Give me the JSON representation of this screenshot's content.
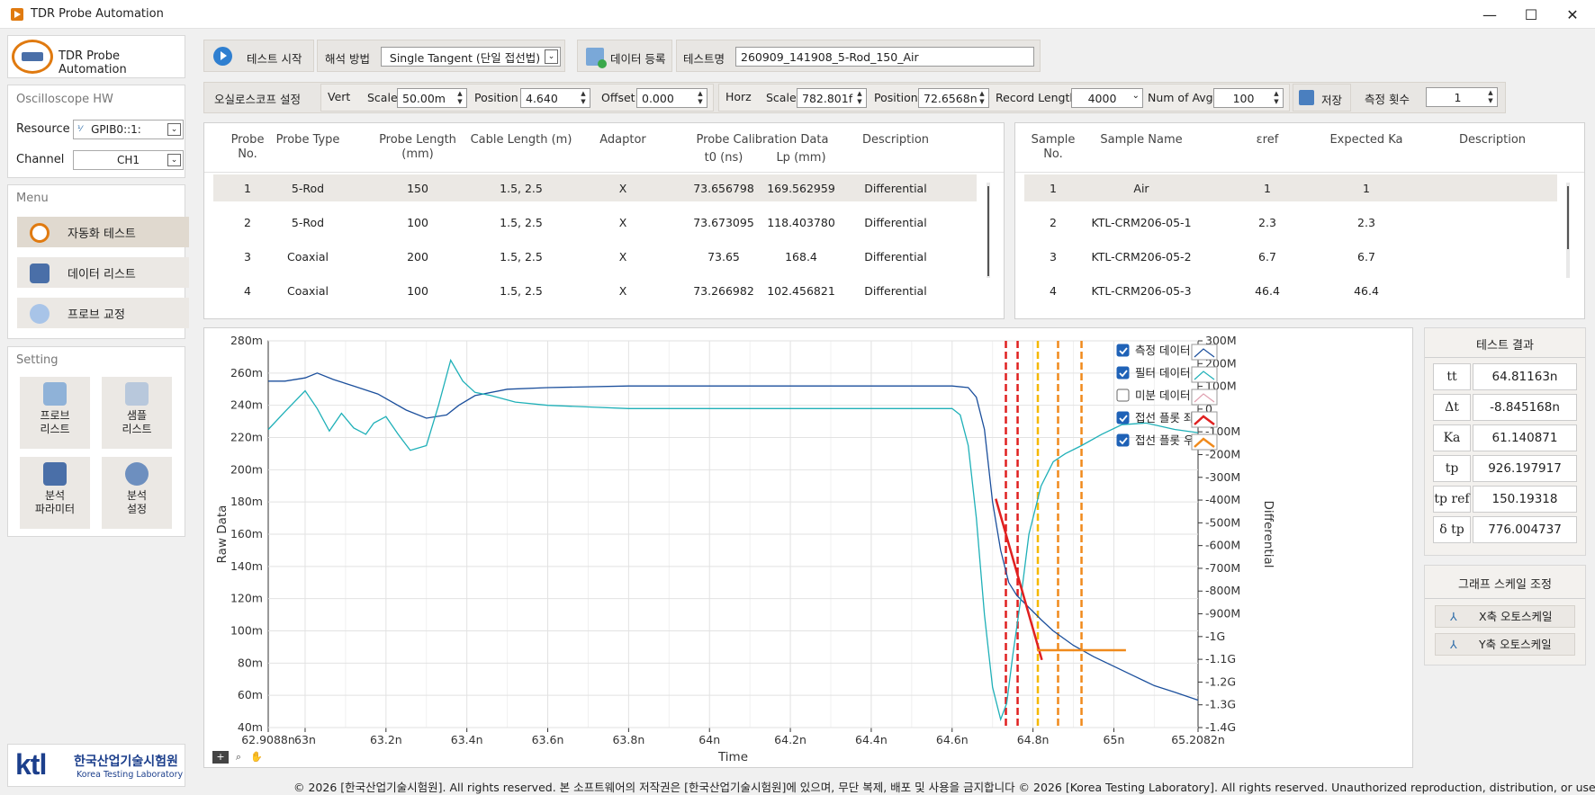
{
  "window": {
    "title": "TDR Probe Automation"
  },
  "sidebar": {
    "app_name": "TDR Probe Automation",
    "osc_hw": {
      "title": "Oscilloscope HW",
      "resource_label": "Resource",
      "resource_value": "GPIB0::1:",
      "channel_label": "Channel",
      "channel_value": "CH1"
    },
    "menu": {
      "title": "Menu",
      "items": [
        {
          "label": "자동화 테스트"
        },
        {
          "label": "데이터 리스트"
        },
        {
          "label": "프로브 교정"
        }
      ]
    },
    "setting": {
      "title": "Setting",
      "buttons": [
        {
          "line1": "프로브",
          "line2": "리스트"
        },
        {
          "line1": "샘플",
          "line2": "리스트"
        },
        {
          "line1": "분석",
          "line2": "파라미터"
        },
        {
          "line1": "분석",
          "line2": "설정"
        }
      ]
    },
    "logo": {
      "brand": "ktl",
      "name_ko": "한국산업기술시험원",
      "name_en": "Korea Testing Laboratory"
    }
  },
  "toolbar": {
    "start_test": "테스트 시작",
    "method_label": "해석 방법",
    "method_value": "Single Tangent (단일 접선법)",
    "register_data": "데이터 등록",
    "test_name_label": "테스트명",
    "test_name_value": "260909_141908_5-Rod_150_Air"
  },
  "scope": {
    "label": "오실로스코프 설정",
    "vert": "Vert",
    "vert_scale_label": "Scale",
    "vert_scale": "50.00m",
    "vert_pos_label": "Position",
    "vert_pos": "4.640",
    "offset_label": "Offset",
    "offset": "0.000",
    "horz": "Horz",
    "horz_scale_label": "Scale",
    "horz_scale": "782.801f",
    "horz_pos_label": "Position",
    "horz_pos": "72.6568n",
    "record_label": "Record Length",
    "record": "4000",
    "avg_label": "Num of Avg",
    "avg": "100",
    "save": "저장",
    "count_label": "측정 횟수",
    "count": "1"
  },
  "probe_table": {
    "headers": [
      "Probe\nNo.",
      "Probe Type",
      "Probe Length\n(mm)",
      "Cable Length (m)",
      "Adaptor",
      "Probe Calibration Data",
      "Description"
    ],
    "calib_sub": [
      "t0 (ns)",
      "Lp (mm)"
    ],
    "rows": [
      {
        "no": "1",
        "type": "5-Rod",
        "length": "150",
        "cable": "1.5, 2.5",
        "adaptor": "X",
        "t0": "73.656798",
        "lp": "169.562959",
        "desc": "Differential"
      },
      {
        "no": "2",
        "type": "5-Rod",
        "length": "100",
        "cable": "1.5, 2.5",
        "adaptor": "X",
        "t0": "73.673095",
        "lp": "118.403780",
        "desc": "Differential"
      },
      {
        "no": "3",
        "type": "Coaxial",
        "length": "200",
        "cable": "1.5, 2.5",
        "adaptor": "X",
        "t0": "73.65",
        "lp": "168.4",
        "desc": "Differential"
      },
      {
        "no": "4",
        "type": "Coaxial",
        "length": "100",
        "cable": "1.5, 2.5",
        "adaptor": "X",
        "t0": "73.266982",
        "lp": "102.456821",
        "desc": "Differential"
      }
    ]
  },
  "sample_table": {
    "headers": [
      "Sample\nNo.",
      "Sample Name",
      "εref",
      "Expected Ka",
      "Description"
    ],
    "rows": [
      {
        "no": "1",
        "name": "Air",
        "eref": "1",
        "ka": "1"
      },
      {
        "no": "2",
        "name": "KTL-CRM206-05-1",
        "eref": "2.3",
        "ka": "2.3"
      },
      {
        "no": "3",
        "name": "KTL-CRM206-05-2",
        "eref": "6.7",
        "ka": "6.7"
      },
      {
        "no": "4",
        "name": "KTL-CRM206-05-3",
        "eref": "46.4",
        "ka": "46.4"
      }
    ]
  },
  "chart_data": {
    "type": "line",
    "xlabel": "Time",
    "ylabel": "Raw Data",
    "y2label": "Differential",
    "xlim": [
      62.9088,
      65.2082
    ],
    "ylim": [
      40,
      280
    ],
    "y2lim": [
      -1400,
      300
    ],
    "x_ticks": [
      "62.9088n",
      "63n",
      "63.2n",
      "63.4n",
      "63.6n",
      "63.8n",
      "64n",
      "64.2n",
      "64.4n",
      "64.6n",
      "64.8n",
      "65n",
      "65.2082n"
    ],
    "y_ticks": [
      "280m",
      "260m",
      "240m",
      "220m",
      "200m",
      "180m",
      "160m",
      "140m",
      "120m",
      "100m",
      "80m",
      "60m",
      "40m"
    ],
    "y2_ticks": [
      "300M",
      "200M",
      "100M",
      "0",
      "-100M",
      "-200M",
      "-300M",
      "-400M",
      "-500M",
      "-600M",
      "-700M",
      "-800M",
      "-900M",
      "-1G",
      "-1.1G",
      "-1.2G",
      "-1.3G",
      "-1.4G"
    ],
    "legend": [
      {
        "label": "측정 데이터",
        "checked": true,
        "color": "#1b4f9c"
      },
      {
        "label": "필터 데이터",
        "checked": true,
        "color": "#1fb0b8"
      },
      {
        "label": "미분 데이터",
        "checked": false,
        "color": "#e0a0b0"
      },
      {
        "label": "접선 플롯 좌",
        "checked": true,
        "color": "#e02020"
      },
      {
        "label": "접선 플롯 우",
        "checked": true,
        "color": "#f08a1c"
      }
    ],
    "series": [
      {
        "name": "측정 데이터",
        "color": "#1b4f9c",
        "axis": "left",
        "x": [
          62.909,
          62.95,
          63.0,
          63.03,
          63.07,
          63.12,
          63.18,
          63.25,
          63.3,
          63.35,
          63.38,
          63.42,
          63.5,
          63.6,
          63.8,
          64.0,
          64.2,
          64.4,
          64.6,
          64.64,
          64.66,
          64.68,
          64.7,
          64.72,
          64.74,
          64.76,
          64.78,
          64.8,
          64.82,
          64.85,
          64.9,
          64.95,
          65.0,
          65.05,
          65.1,
          65.15,
          65.208
        ],
        "y": [
          255,
          255,
          257,
          260,
          256,
          252,
          247,
          237,
          232,
          234,
          240,
          246,
          250,
          251,
          252,
          252,
          252,
          252,
          252,
          251,
          245,
          225,
          180,
          150,
          130,
          122,
          117,
          112,
          107,
          100,
          91,
          84,
          78,
          72,
          66,
          62,
          57
        ]
      },
      {
        "name": "필터 데이터",
        "color": "#1fb0b8",
        "axis": "left",
        "x": [
          62.909,
          62.95,
          63.0,
          63.03,
          63.06,
          63.09,
          63.12,
          63.15,
          63.17,
          63.2,
          63.23,
          63.26,
          63.3,
          63.33,
          63.36,
          63.39,
          63.42,
          63.46,
          63.52,
          63.6,
          63.7,
          63.8,
          64.0,
          64.2,
          64.4,
          64.6,
          64.62,
          64.64,
          64.66,
          64.68,
          64.7,
          64.72,
          64.735,
          64.75,
          64.77,
          64.79,
          64.82,
          64.85,
          64.88,
          64.92,
          64.97,
          65.02,
          65.08,
          65.15,
          65.208
        ],
        "y": [
          225,
          236,
          249,
          238,
          224,
          235,
          226,
          222,
          229,
          233,
          222,
          212,
          215,
          240,
          268,
          255,
          248,
          246,
          242,
          240,
          239,
          238,
          238,
          238,
          238,
          238,
          234,
          215,
          170,
          110,
          65,
          45,
          55,
          85,
          120,
          160,
          190,
          205,
          210,
          215,
          222,
          228,
          229,
          225,
          223
        ]
      },
      {
        "name": "접선 플롯 좌",
        "color": "#e02020",
        "axis": "left",
        "x": [
          64.708,
          64.822
        ],
        "y": [
          182,
          82
        ]
      },
      {
        "name": "접선 플롯 우",
        "color": "#f08a1c",
        "axis": "left",
        "x": [
          64.81,
          65.03
        ],
        "y": [
          88,
          88
        ]
      }
    ],
    "markers_left": [
      64.733,
      64.762
    ],
    "markers_right": [
      64.812,
      64.862,
      64.92
    ]
  },
  "results": {
    "title": "테스트 결과",
    "items": [
      {
        "key": "tt",
        "value": "64.81163n"
      },
      {
        "key": "Δt",
        "value": "-8.845168n"
      },
      {
        "key": "Ka",
        "value": "61.140871"
      },
      {
        "key": "tp",
        "value": "926.197917"
      },
      {
        "key": "tp ref",
        "value": "150.19318"
      },
      {
        "key": "δ tp",
        "value": "776.004737"
      }
    ],
    "scale_title": "그래프 스케일 조정",
    "x_auto": "X축 오토스케일",
    "y_auto": "Y축 오토스케일"
  },
  "footer": "© 2026 [한국산업기술시험원]. All rights reserved. 본 소프트웨어의 저작권은 [한국산업기술시험원]에 있으며, 무단 복제, 배포 및 사용을 금지합니다 © 2026 [Korea Testing Laboratory]. All rights reserved. Unauthorized reproduction, distribution, or use is prohibited."
}
